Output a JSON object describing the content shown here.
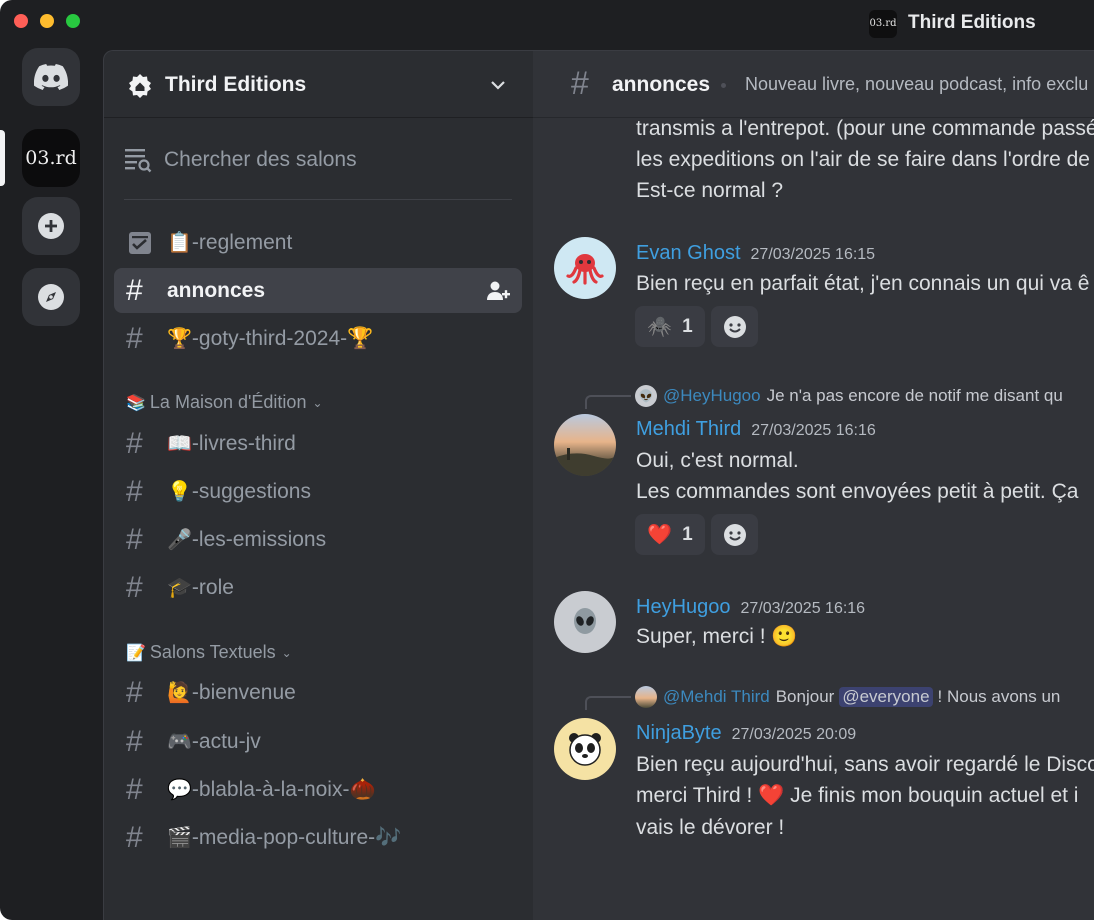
{
  "window": {
    "title": "Third Editions",
    "logo_text": "03.rd"
  },
  "rail": {
    "items": [
      {
        "name": "discord-home",
        "icon": "discord-icon"
      },
      {
        "name": "server-third-editions",
        "label": "03.rd"
      },
      {
        "name": "add-server",
        "icon": "plus-icon"
      },
      {
        "name": "explore",
        "icon": "compass-icon"
      }
    ]
  },
  "sidebar": {
    "guild_name": "Third Editions",
    "browse_label": "Chercher des salons",
    "channels_top": [
      {
        "emoji": "📋",
        "name": "-reglement",
        "type": "rules"
      },
      {
        "emoji": "",
        "name": "annonces",
        "active": true
      },
      {
        "emoji": "🏆",
        "name": "-goty-third-2024-🏆"
      }
    ],
    "category1": {
      "emoji": "📚",
      "label": "La Maison d'Édition"
    },
    "channels_cat1": [
      {
        "emoji": "📖",
        "name": "-livres-third"
      },
      {
        "emoji": "💡",
        "name": "-suggestions"
      },
      {
        "emoji": "🎤",
        "name": "-les-emissions"
      },
      {
        "emoji": "🎓",
        "name": "-role"
      }
    ],
    "category2": {
      "emoji": "📝",
      "label": "Salons Textuels"
    },
    "channels_cat2": [
      {
        "emoji": "🙋",
        "name": "-bienvenue"
      },
      {
        "emoji": "🎮",
        "name": "-actu-jv"
      },
      {
        "emoji": "💬",
        "name": "-blabla-à-la-noix-🌰"
      },
      {
        "emoji": "🎬",
        "name": "-media-pop-culture-🎶"
      }
    ]
  },
  "chat": {
    "channel_name": "annonces",
    "topic": "Nouveau livre, nouveau podcast, info exclu",
    "prev_lines": [
      "transmis a l'entrepot. (pour une commande passée",
      "les expeditions on l'air de se faire dans l'ordre de",
      "Est-ce normal ?"
    ],
    "messages": [
      {
        "author": "Evan Ghost",
        "timestamp": "27/03/2025 16:15",
        "lines": [
          "Bien reçu en parfait état, j'en connais un qui va ê"
        ],
        "reactions": [
          {
            "emoji": "🕷️",
            "count": "1"
          }
        ]
      },
      {
        "reply": {
          "who": "@HeyHugoo",
          "text": "Je n'a pas encore de notif me disant qu"
        },
        "author": "Mehdi Third",
        "timestamp": "27/03/2025 16:16",
        "lines": [
          "Oui, c'est normal.",
          "Les commandes sont envoyées petit à petit. Ça"
        ],
        "reactions": [
          {
            "emoji": "❤️",
            "count": "1"
          }
        ]
      },
      {
        "author": "HeyHugoo",
        "timestamp": "27/03/2025 16:16",
        "lines": [
          "Super, merci ! 🙂"
        ]
      },
      {
        "reply": {
          "who": "@Mehdi Third",
          "pre": "Bonjour",
          "mention": "@everyone",
          "text": "! Nous avons un"
        },
        "author": "NinjaByte",
        "timestamp": "27/03/2025 20:09",
        "lines": [
          "Bien reçu aujourd'hui, sans avoir regardé le Disco",
          "merci Third ! ❤️ Je finis mon bouquin actuel et i",
          "vais le dévorer !"
        ]
      }
    ]
  },
  "colors": {
    "accent_link": "#3f9fe0",
    "bg_rail": "#1e1f22",
    "bg_sidebar": "#2b2d31",
    "bg_chat": "#313338",
    "active_channel": "#404249"
  }
}
